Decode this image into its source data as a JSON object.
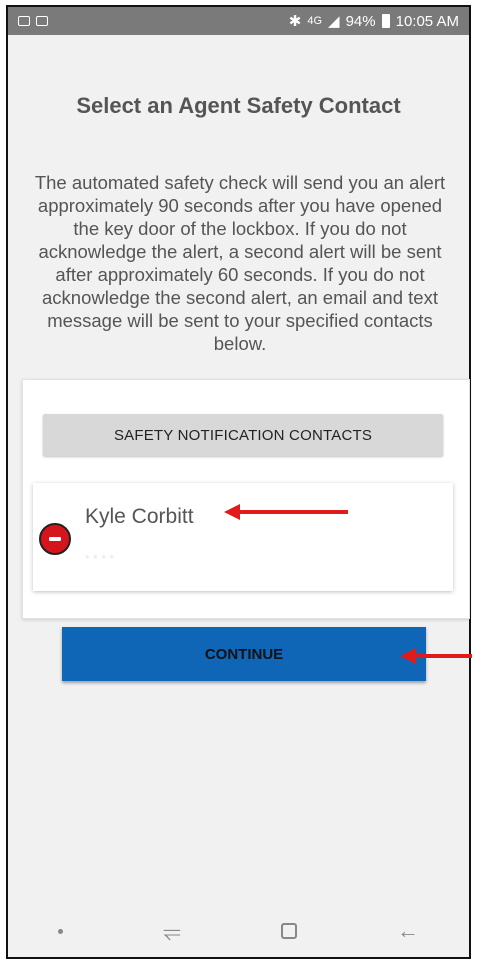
{
  "status_bar": {
    "network": "4G",
    "battery": "94%",
    "time": "10:05 AM",
    "left_icons": [
      "mail-icon",
      "image-icon"
    ],
    "right_icons": [
      "bluetooth-icon",
      "signal-icon",
      "battery-icon"
    ]
  },
  "page": {
    "title": "Select an Agent Safety Contact",
    "description": "The automated safety check will send you an alert approximately 90 seconds after you have opened the key door of the lockbox. If you do not acknowledge the alert, a second alert will be sent after approximately 60 seconds. If you do not acknowledge the second alert, an email and text message will be sent to your specified contacts below."
  },
  "contacts": {
    "header_label": "SAFETY NOTIFICATION CONTACTS",
    "items": [
      {
        "name": "Kyle Corbitt",
        "remove_icon": "remove-circle-icon"
      }
    ]
  },
  "actions": {
    "continue_label": "CONTINUE"
  },
  "annotations": {
    "arrow_color": "#e01b1b"
  },
  "colors": {
    "primary_button": "#0f66b6",
    "remove": "#d6141c",
    "status_bar": "#7a7a7a"
  },
  "nav_bar": {
    "icons": [
      "dot-icon",
      "recent-apps-icon",
      "home-icon",
      "back-icon"
    ]
  }
}
